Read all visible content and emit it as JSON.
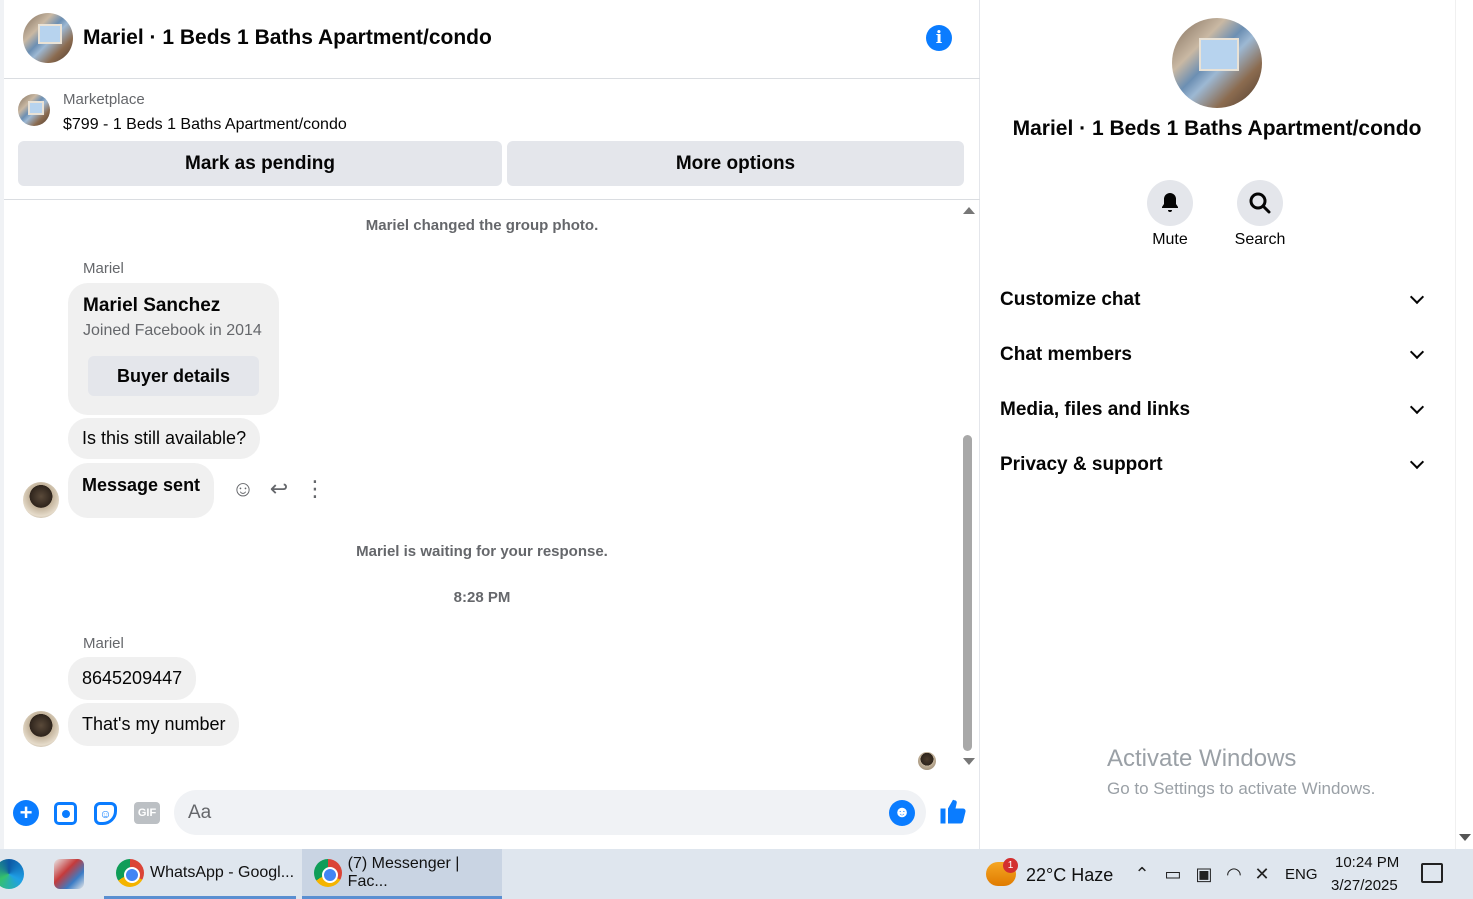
{
  "chat": {
    "title": "Mariel · 1 Beds 1 Baths Apartment/condo",
    "listing": {
      "source": "Marketplace",
      "price_line": "$799 - 1 Beds 1 Baths Apartment/condo",
      "mark_pending_label": "Mark as pending",
      "more_options_label": "More options"
    },
    "messages": {
      "system_group_photo": "Mariel changed the group photo.",
      "sender_1": "Mariel",
      "card": {
        "name": "Mariel Sanchez",
        "joined": "Joined Facebook in 2014",
        "button": "Buyer details"
      },
      "bubble_available": "Is this still available?",
      "bubble_sent": "Message sent",
      "system_waiting": "Mariel is waiting for your response.",
      "timestamp": "8:28 PM",
      "sender_2": "Mariel",
      "bubble_number": "8645209447",
      "bubble_my_number": "That's my number"
    },
    "composer": {
      "placeholder": "Aa",
      "gif_label": "GIF"
    }
  },
  "info_panel": {
    "title": "Mariel · 1 Beds 1 Baths Apartment/condo",
    "mute_label": "Mute",
    "search_label": "Search",
    "sections": [
      "Customize chat",
      "Chat members",
      "Media, files and links",
      "Privacy & support"
    ],
    "watermark_title": "Activate Windows",
    "watermark_sub": "Go to Settings to activate Windows."
  },
  "taskbar": {
    "task_whatsapp": "WhatsApp - Googl...",
    "task_messenger": "(7) Messenger | Fac...",
    "weather_badge": "1",
    "weather": "22°C  Haze",
    "language": "ENG",
    "time": "10:24 PM",
    "date": "3/27/2025"
  },
  "colors": {
    "accent": "#0a7cff",
    "bubble": "#f0f0f0",
    "button": "#e4e6eb",
    "secondary_text": "#65676b",
    "taskbar": "#dfe6ee"
  },
  "icons": [
    "info-icon",
    "smile-icon",
    "reply-icon",
    "more-vertical-icon",
    "plus-icon",
    "image-icon",
    "sticker-icon",
    "gif-icon",
    "emoji-icon",
    "like-icon",
    "bell-icon",
    "search-icon",
    "chevron-down-icon"
  ]
}
